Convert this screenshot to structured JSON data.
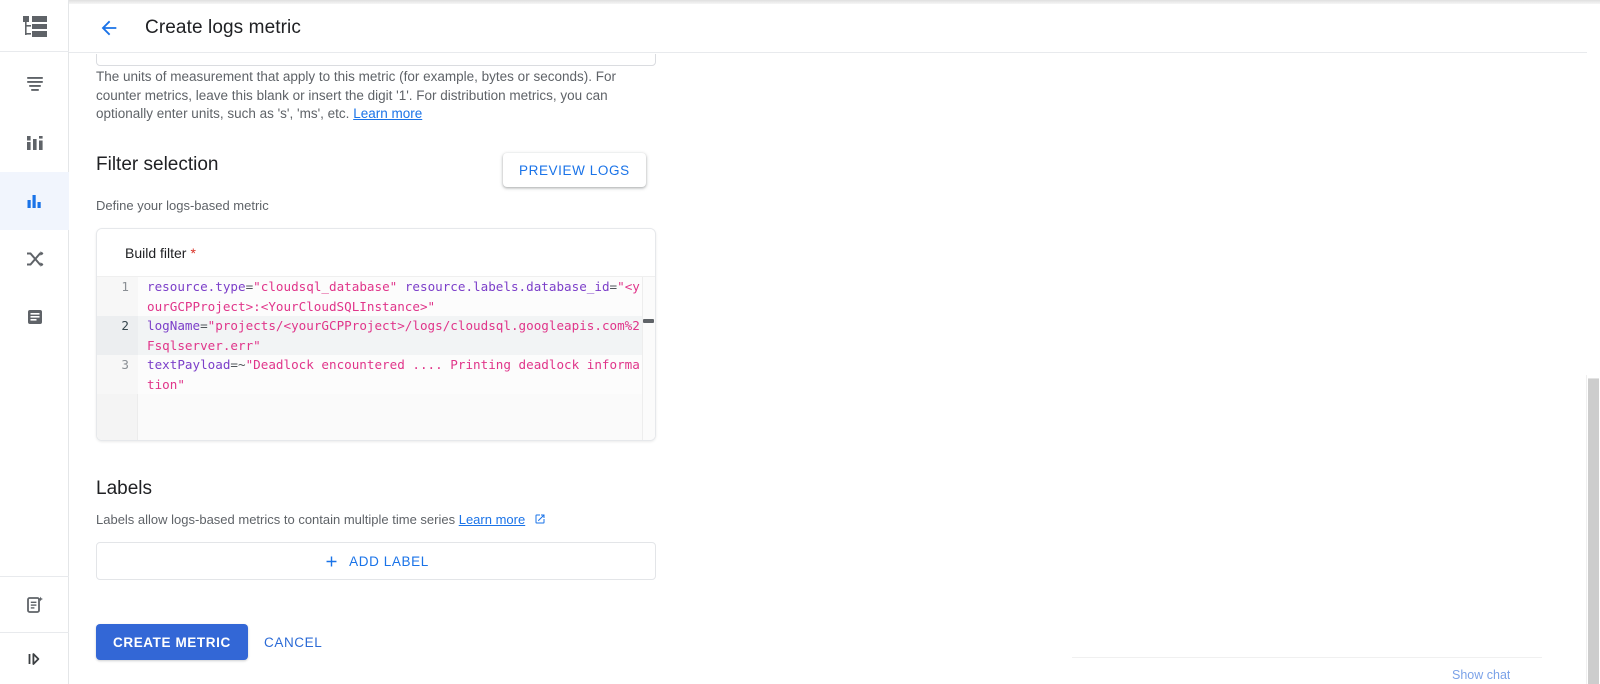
{
  "window": {
    "title": "Create logs metric"
  },
  "rail": {
    "logo_icon": "hierarchy-logo-icon",
    "items": [
      {
        "icon": "logs-list-icon",
        "name": "logs-explorer",
        "active": false
      },
      {
        "icon": "log-storage-icon",
        "name": "log-storage",
        "active": false
      },
      {
        "icon": "logs-metrics-icon",
        "name": "logs-metrics",
        "active": true
      },
      {
        "icon": "logs-router-icon",
        "name": "logs-router",
        "active": false
      },
      {
        "icon": "log-analytics-icon",
        "name": "log-analytics",
        "active": false
      }
    ],
    "bottom_items": [
      {
        "icon": "create-metric-icon",
        "name": "create-metric-shortcut"
      },
      {
        "icon": "expand-panel-icon",
        "name": "expand-panel"
      }
    ]
  },
  "header": {
    "back_icon": "back-arrow-icon",
    "title": "Create logs metric"
  },
  "units_field": {
    "value": "",
    "placeholder": "",
    "helper_text": "The units of measurement that apply to this metric (for example, bytes or seconds). For counter metrics, leave this blank or insert the digit '1'. For distribution metrics, you can optionally enter units, such as 's', 'ms', etc. ",
    "helper_link": "Learn more"
  },
  "filter_selection": {
    "title": "Filter selection",
    "subtitle": "Define your logs-based metric",
    "preview_button": "PREVIEW LOGS",
    "build_filter_label": "Build filter",
    "required_marker": "*",
    "lines": [
      {
        "number": "1",
        "active": false,
        "tokens": [
          {
            "t": "key",
            "v": "resource.type"
          },
          {
            "t": "op",
            "v": "="
          },
          {
            "t": "str",
            "v": "\"cloudsql_database\""
          },
          {
            "t": "key",
            "v": " resource.labels.database_id"
          },
          {
            "t": "op",
            "v": "="
          },
          {
            "t": "str",
            "v": "\"<yourGCPProject>:<YourCloudSQLInstance>\""
          }
        ]
      },
      {
        "number": "2",
        "active": true,
        "tokens": [
          {
            "t": "key",
            "v": "logName"
          },
          {
            "t": "op",
            "v": "="
          },
          {
            "t": "str",
            "v": "\"projects/<yourGCPProject>/logs/cloudsql.googleapis.com%2Fsqlserver.err\""
          }
        ]
      },
      {
        "number": "3",
        "active": false,
        "tokens": [
          {
            "t": "key",
            "v": "textPayload"
          },
          {
            "t": "op",
            "v": "=~"
          },
          {
            "t": "str",
            "v": "\"Deadlock encountered .... Printing deadlock information\""
          }
        ]
      }
    ]
  },
  "labels": {
    "title": "Labels",
    "subtitle": "Labels allow logs-based metrics to contain multiple time series ",
    "subtitle_link": "Learn more",
    "external_icon": "external-link-icon",
    "add_button": "ADD LABEL",
    "add_icon": "plus-icon"
  },
  "actions": {
    "create": "CREATE METRIC",
    "cancel": "CANCEL"
  },
  "footer": {
    "chat_link": "Show chat"
  },
  "colors": {
    "accent_blue": "#1a73e8",
    "primary_button": "#3367d6",
    "required_red": "#d93025",
    "code_identifier": "#7c3fc9",
    "code_string": "#e0358a",
    "rail_active_bg": "#f1f5fd"
  }
}
